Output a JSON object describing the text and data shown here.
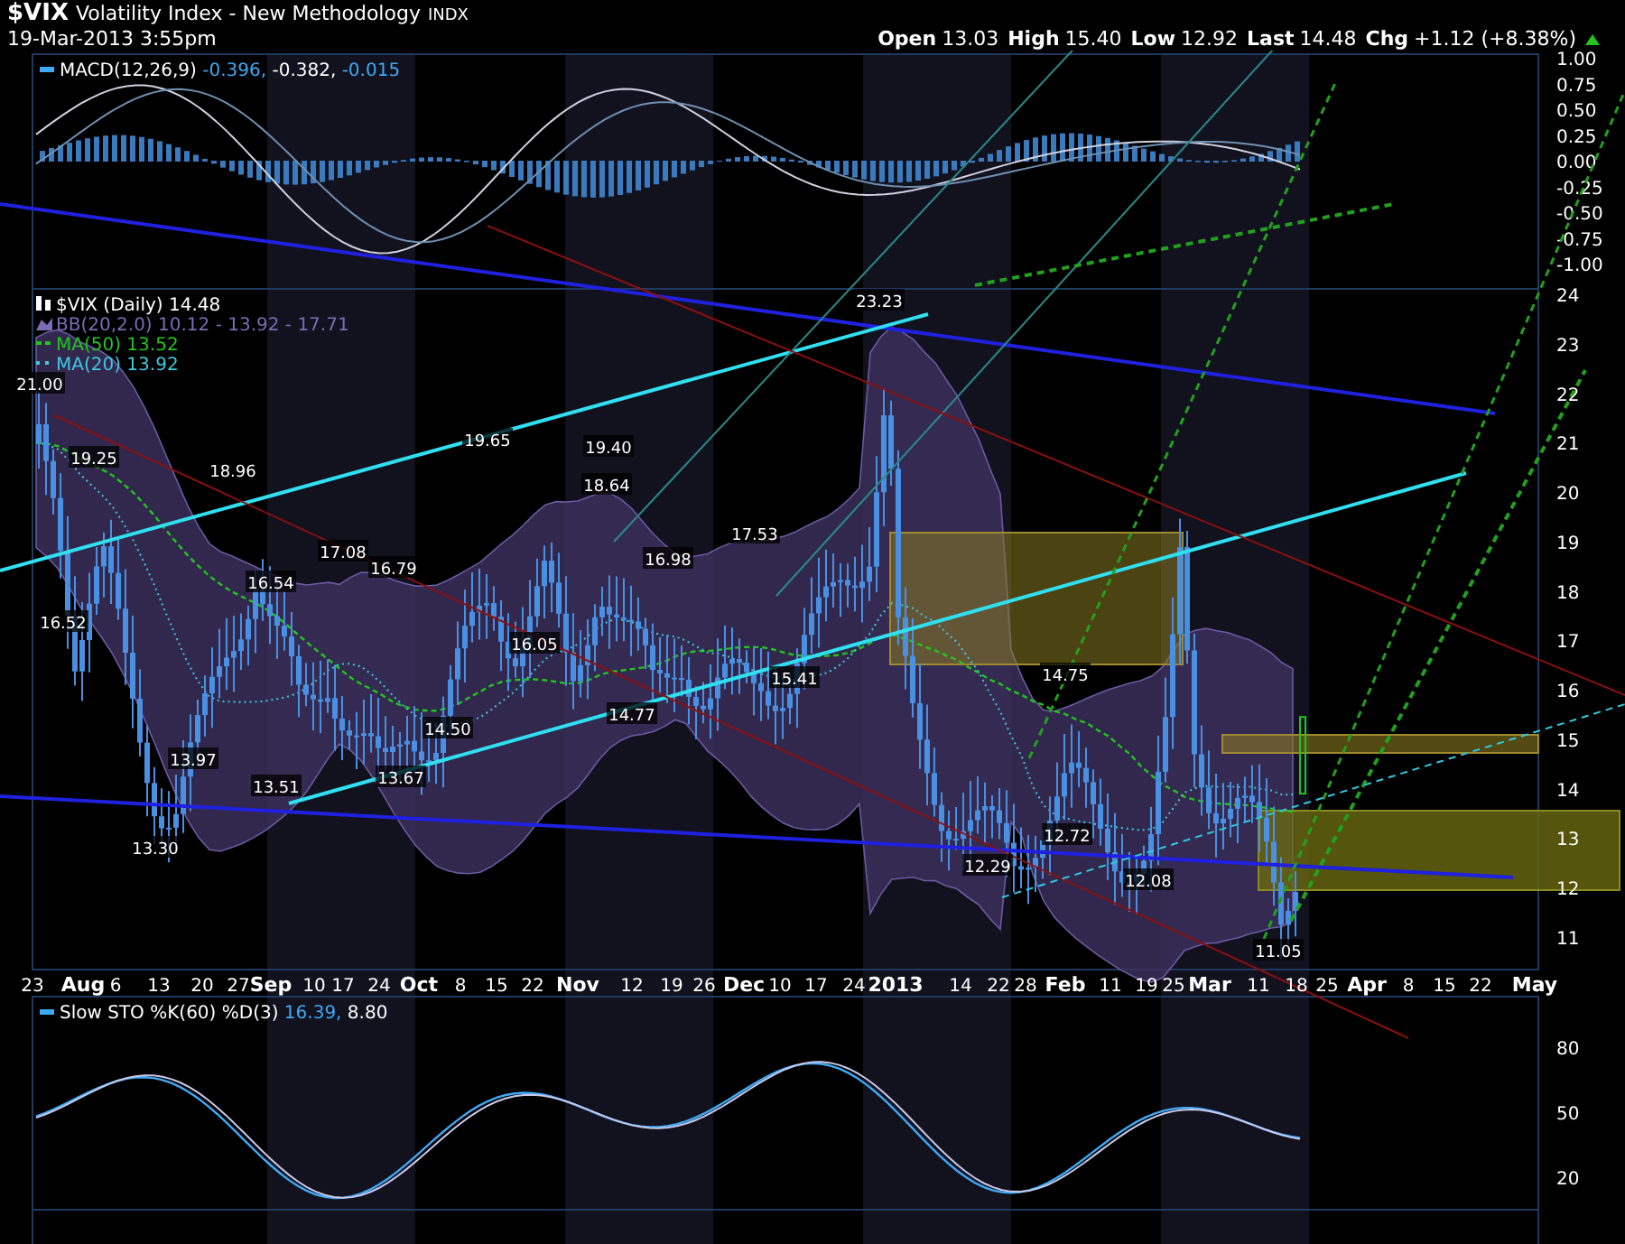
{
  "header": {
    "symbol": "$VIX",
    "name": "Volatility Index - New Methodology",
    "exchange": "INDX",
    "datetime": "19-Mar-2013 3:55pm",
    "quote": [
      {
        "label": "Open",
        "value": "13.03"
      },
      {
        "label": "High",
        "value": "15.40"
      },
      {
        "label": "Low",
        "value": "12.92"
      },
      {
        "label": "Last",
        "value": "14.48"
      },
      {
        "label": "Chg",
        "value": "+1.12 (+8.38%)"
      }
    ]
  },
  "macd_panel": {
    "legend": {
      "label": "MACD(12,26,9)",
      "values": [
        {
          "text": "-0.396,",
          "color": "#3fa9f5"
        },
        {
          "text": "-0.382,",
          "color": "#ffffff"
        },
        {
          "text": "-0.015",
          "color": "#3fa9f5"
        }
      ]
    },
    "axis": [
      "1.00",
      "0.75",
      "0.50",
      "0.25",
      "0.00",
      "-0.25",
      "-0.50",
      "-0.75",
      "-1.00"
    ]
  },
  "price_panel": {
    "legend": [
      {
        "kind": "candles",
        "text": "$VIX (Daily) 14.48",
        "color": "#ffffff"
      },
      {
        "kind": "band",
        "text": "BB(20,2.0) 10.12 - 13.92 - 17.71",
        "color": "#7b6bb5"
      },
      {
        "kind": "dashed",
        "text": "MA(50) 13.52",
        "color": "#22c41e"
      },
      {
        "kind": "dotted",
        "text": "MA(20) 13.92",
        "color": "#3fc8e0"
      }
    ],
    "axis": [
      "24",
      "23",
      "22",
      "21",
      "20",
      "19",
      "18",
      "17",
      "16",
      "15",
      "14",
      "13",
      "12",
      "11"
    ],
    "annotations": [
      "21.00",
      "19.25",
      "16.52",
      "13.30",
      "18.96",
      "16.54",
      "13.97",
      "13.51",
      "17.08",
      "16.79",
      "13.67",
      "14.50",
      "19.65",
      "16.05",
      "19.40",
      "18.64",
      "16.98",
      "14.77",
      "17.53",
      "15.41",
      "23.23",
      "14.75",
      "12.29",
      "12.72",
      "12.08",
      "11.05"
    ]
  },
  "x_axis": [
    {
      "kind": "day",
      "text": "23"
    },
    {
      "kind": "month",
      "text": "Aug"
    },
    {
      "kind": "day",
      "text": "6"
    },
    {
      "kind": "day",
      "text": "13"
    },
    {
      "kind": "day",
      "text": "20"
    },
    {
      "kind": "day",
      "text": "27"
    },
    {
      "kind": "month",
      "text": "Sep"
    },
    {
      "kind": "day",
      "text": "10"
    },
    {
      "kind": "day",
      "text": "17"
    },
    {
      "kind": "day",
      "text": "24"
    },
    {
      "kind": "month",
      "text": "Oct"
    },
    {
      "kind": "day",
      "text": "8"
    },
    {
      "kind": "day",
      "text": "15"
    },
    {
      "kind": "day",
      "text": "22"
    },
    {
      "kind": "month",
      "text": "Nov"
    },
    {
      "kind": "day",
      "text": "12"
    },
    {
      "kind": "day",
      "text": "19"
    },
    {
      "kind": "day",
      "text": "26"
    },
    {
      "kind": "month",
      "text": "Dec"
    },
    {
      "kind": "day",
      "text": "10"
    },
    {
      "kind": "day",
      "text": "17"
    },
    {
      "kind": "day",
      "text": "24"
    },
    {
      "kind": "month",
      "text": "2013"
    },
    {
      "kind": "day",
      "text": "14"
    },
    {
      "kind": "day",
      "text": "22"
    },
    {
      "kind": "day",
      "text": "28"
    },
    {
      "kind": "month",
      "text": "Feb"
    },
    {
      "kind": "day",
      "text": "11"
    },
    {
      "kind": "day",
      "text": "19"
    },
    {
      "kind": "day",
      "text": "25"
    },
    {
      "kind": "month",
      "text": "Mar"
    },
    {
      "kind": "day",
      "text": "11"
    },
    {
      "kind": "day",
      "text": "18"
    },
    {
      "kind": "day",
      "text": "25"
    },
    {
      "kind": "month",
      "text": "Apr"
    },
    {
      "kind": "day",
      "text": "8"
    },
    {
      "kind": "day",
      "text": "15"
    },
    {
      "kind": "day",
      "text": "22"
    },
    {
      "kind": "month",
      "text": "May"
    }
  ],
  "sto_panel": {
    "legend": {
      "label": "Slow STO %K(60) %D(3)",
      "values": [
        {
          "text": "16.39,",
          "color": "#3fa9f5"
        },
        {
          "text": "8.80",
          "color": "#ffffff"
        }
      ]
    },
    "axis": [
      "80",
      "50",
      "20"
    ]
  }
}
